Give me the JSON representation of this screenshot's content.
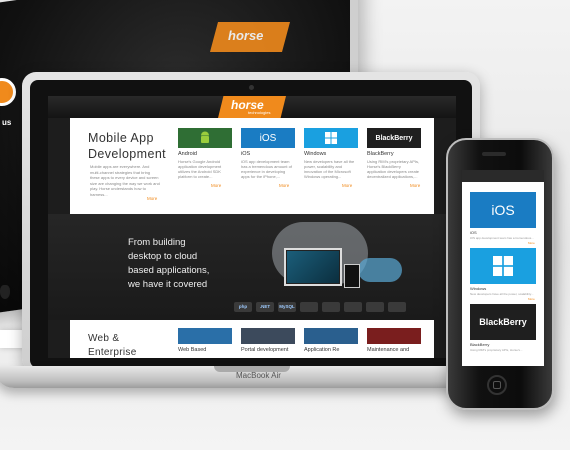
{
  "background": {
    "tab_label": "us",
    "logo_text": "horse"
  },
  "laptop": {
    "brand_label": "MacBook Air",
    "site": {
      "logo_text": "horse",
      "logo_sub": "technologies",
      "mobile": {
        "title_line1": "Mobile App",
        "title_line2": "Development",
        "description": "Mobile apps are everywhere. And multi-channel strategies that bring these apps to every device and screen size are changing the way we work and play. Horse understands how to harness...",
        "more": "More"
      },
      "tiles": [
        {
          "label": "Android",
          "img_text": "",
          "desc": "Horse's Google Android application development utilizes the Android SDK platform to create...",
          "more": "More",
          "bg": "#2f6e34",
          "icon": "android-icon"
        },
        {
          "label": "iOS",
          "img_text": "iOS",
          "desc": "iOS app development team has a tremendous amount of experience in developing apps for the iPhone,...",
          "more": "More",
          "bg": "#1a7cc3",
          "icon": "apple-icon"
        },
        {
          "label": "Windows",
          "img_text": "",
          "desc": "New developers have all the power, scalability and innovation of the Microsoft Windows operating...",
          "more": "More",
          "bg": "#1aa0e0",
          "icon": "windows-icon"
        },
        {
          "label": "BlackBerry",
          "img_text": "BlackBerry",
          "desc": "Using RIM's proprietary APIs, Horse's BlackBerry application developers create decentralized applications,...",
          "more": "More",
          "bg": "#1f1f1f",
          "icon": "blackberry-icon"
        }
      ],
      "hero": {
        "line1": "From building",
        "line2": "desktop to cloud",
        "line3": "based applications,",
        "line4": "we have it covered"
      },
      "tech_icons": [
        "php",
        ".NET",
        "MySQL",
        "",
        "",
        "",
        "",
        ""
      ],
      "web": {
        "title_line1": "Web &",
        "title_line2": "Enterprise"
      },
      "bottom_tiles": [
        {
          "label": "Web Based",
          "bg": "#2a6fa8"
        },
        {
          "label": "Portal development",
          "bg": "#3c4a5c"
        },
        {
          "label": "Application Re",
          "bg": "#2a5f8e"
        },
        {
          "label": "Maintenance and",
          "bg": "#7a1e1e"
        }
      ]
    }
  },
  "phone": {
    "tiles": [
      {
        "img_text": "iOS",
        "bg": "#1a7cc3",
        "label": "iOS",
        "desc": "iOS app development team has a tremendous...",
        "more": "More"
      },
      {
        "img_text": "",
        "bg": "#1aa0e0",
        "label": "Windows",
        "desc": "New developers have all the power, scalability...",
        "more": "More"
      },
      {
        "img_text": "BlackBerry",
        "bg": "#1f1f1f",
        "label": "BlackBerry",
        "desc": "Using RIM's proprietary APIs, Horse's...",
        "more": "More"
      }
    ]
  },
  "colors": {
    "accent": "#f08a1c"
  }
}
